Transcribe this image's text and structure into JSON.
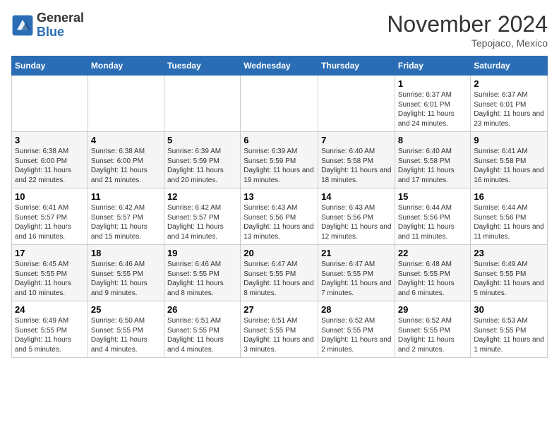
{
  "logo": {
    "general": "General",
    "blue": "Blue"
  },
  "title": "November 2024",
  "location": "Tepojaco, Mexico",
  "days_header": [
    "Sunday",
    "Monday",
    "Tuesday",
    "Wednesday",
    "Thursday",
    "Friday",
    "Saturday"
  ],
  "weeks": [
    [
      {
        "day": "",
        "info": ""
      },
      {
        "day": "",
        "info": ""
      },
      {
        "day": "",
        "info": ""
      },
      {
        "day": "",
        "info": ""
      },
      {
        "day": "",
        "info": ""
      },
      {
        "day": "1",
        "info": "Sunrise: 6:37 AM\nSunset: 6:01 PM\nDaylight: 11 hours and 24 minutes."
      },
      {
        "day": "2",
        "info": "Sunrise: 6:37 AM\nSunset: 6:01 PM\nDaylight: 11 hours and 23 minutes."
      }
    ],
    [
      {
        "day": "3",
        "info": "Sunrise: 6:38 AM\nSunset: 6:00 PM\nDaylight: 11 hours and 22 minutes."
      },
      {
        "day": "4",
        "info": "Sunrise: 6:38 AM\nSunset: 6:00 PM\nDaylight: 11 hours and 21 minutes."
      },
      {
        "day": "5",
        "info": "Sunrise: 6:39 AM\nSunset: 5:59 PM\nDaylight: 11 hours and 20 minutes."
      },
      {
        "day": "6",
        "info": "Sunrise: 6:39 AM\nSunset: 5:59 PM\nDaylight: 11 hours and 19 minutes."
      },
      {
        "day": "7",
        "info": "Sunrise: 6:40 AM\nSunset: 5:58 PM\nDaylight: 11 hours and 18 minutes."
      },
      {
        "day": "8",
        "info": "Sunrise: 6:40 AM\nSunset: 5:58 PM\nDaylight: 11 hours and 17 minutes."
      },
      {
        "day": "9",
        "info": "Sunrise: 6:41 AM\nSunset: 5:58 PM\nDaylight: 11 hours and 16 minutes."
      }
    ],
    [
      {
        "day": "10",
        "info": "Sunrise: 6:41 AM\nSunset: 5:57 PM\nDaylight: 11 hours and 16 minutes."
      },
      {
        "day": "11",
        "info": "Sunrise: 6:42 AM\nSunset: 5:57 PM\nDaylight: 11 hours and 15 minutes."
      },
      {
        "day": "12",
        "info": "Sunrise: 6:42 AM\nSunset: 5:57 PM\nDaylight: 11 hours and 14 minutes."
      },
      {
        "day": "13",
        "info": "Sunrise: 6:43 AM\nSunset: 5:56 PM\nDaylight: 11 hours and 13 minutes."
      },
      {
        "day": "14",
        "info": "Sunrise: 6:43 AM\nSunset: 5:56 PM\nDaylight: 11 hours and 12 minutes."
      },
      {
        "day": "15",
        "info": "Sunrise: 6:44 AM\nSunset: 5:56 PM\nDaylight: 11 hours and 11 minutes."
      },
      {
        "day": "16",
        "info": "Sunrise: 6:44 AM\nSunset: 5:56 PM\nDaylight: 11 hours and 11 minutes."
      }
    ],
    [
      {
        "day": "17",
        "info": "Sunrise: 6:45 AM\nSunset: 5:55 PM\nDaylight: 11 hours and 10 minutes."
      },
      {
        "day": "18",
        "info": "Sunrise: 6:46 AM\nSunset: 5:55 PM\nDaylight: 11 hours and 9 minutes."
      },
      {
        "day": "19",
        "info": "Sunrise: 6:46 AM\nSunset: 5:55 PM\nDaylight: 11 hours and 8 minutes."
      },
      {
        "day": "20",
        "info": "Sunrise: 6:47 AM\nSunset: 5:55 PM\nDaylight: 11 hours and 8 minutes."
      },
      {
        "day": "21",
        "info": "Sunrise: 6:47 AM\nSunset: 5:55 PM\nDaylight: 11 hours and 7 minutes."
      },
      {
        "day": "22",
        "info": "Sunrise: 6:48 AM\nSunset: 5:55 PM\nDaylight: 11 hours and 6 minutes."
      },
      {
        "day": "23",
        "info": "Sunrise: 6:49 AM\nSunset: 5:55 PM\nDaylight: 11 hours and 5 minutes."
      }
    ],
    [
      {
        "day": "24",
        "info": "Sunrise: 6:49 AM\nSunset: 5:55 PM\nDaylight: 11 hours and 5 minutes."
      },
      {
        "day": "25",
        "info": "Sunrise: 6:50 AM\nSunset: 5:55 PM\nDaylight: 11 hours and 4 minutes."
      },
      {
        "day": "26",
        "info": "Sunrise: 6:51 AM\nSunset: 5:55 PM\nDaylight: 11 hours and 4 minutes."
      },
      {
        "day": "27",
        "info": "Sunrise: 6:51 AM\nSunset: 5:55 PM\nDaylight: 11 hours and 3 minutes."
      },
      {
        "day": "28",
        "info": "Sunrise: 6:52 AM\nSunset: 5:55 PM\nDaylight: 11 hours and 2 minutes."
      },
      {
        "day": "29",
        "info": "Sunrise: 6:52 AM\nSunset: 5:55 PM\nDaylight: 11 hours and 2 minutes."
      },
      {
        "day": "30",
        "info": "Sunrise: 6:53 AM\nSunset: 5:55 PM\nDaylight: 11 hours and 1 minute."
      }
    ]
  ]
}
